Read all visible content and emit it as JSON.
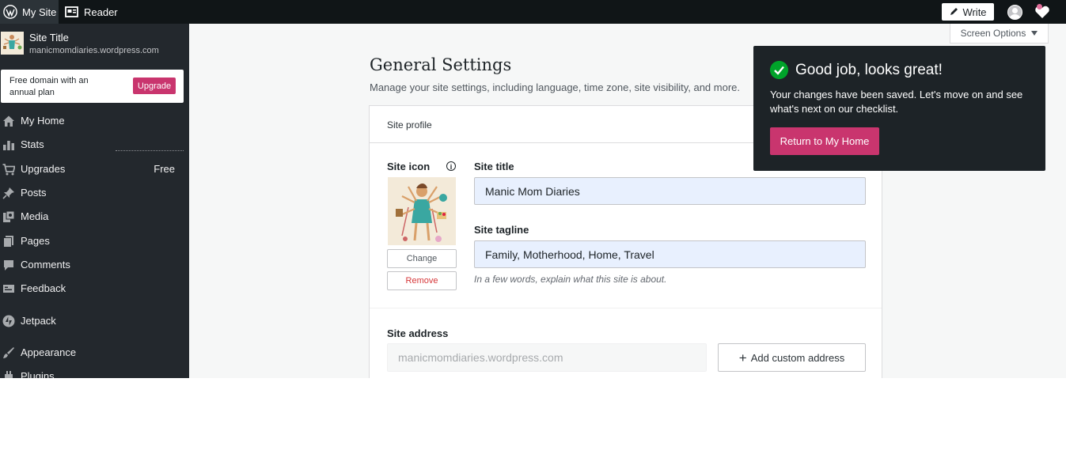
{
  "topbar": {
    "my_site": "My Site",
    "reader": "Reader",
    "write": "Write",
    "icons": [
      "wordpress-icon",
      "reader-icon",
      "pencil-icon",
      "avatar-icon",
      "notifications-icon"
    ]
  },
  "sidebar": {
    "site_title": "Site Title",
    "site_url": "manicmomdiaries.wordpress.com",
    "domain_promo": "Free domain with an annual plan",
    "upgrade_label": "Upgrade",
    "items": [
      {
        "label": "My Home",
        "icon": "home-icon"
      },
      {
        "label": "Stats",
        "icon": "stats-icon"
      },
      {
        "label": "Upgrades",
        "icon": "cart-icon",
        "badge": "Free"
      },
      {
        "label": "Posts",
        "icon": "pin-icon"
      },
      {
        "label": "Media",
        "icon": "media-icon"
      },
      {
        "label": "Pages",
        "icon": "pages-icon"
      },
      {
        "label": "Comments",
        "icon": "comment-icon"
      },
      {
        "label": "Feedback",
        "icon": "feedback-icon"
      },
      {
        "label": "Jetpack",
        "icon": "jetpack-icon"
      },
      {
        "label": "Appearance",
        "icon": "brush-icon"
      },
      {
        "label": "Plugins",
        "icon": "plugin-icon"
      }
    ]
  },
  "main": {
    "screen_options": "Screen Options",
    "title": "General Settings",
    "subtitle": "Manage your site settings, including language, time zone, site visibility, and more.",
    "card_header": "Site profile",
    "site_icon_label": "Site icon",
    "change_label": "Change",
    "remove_label": "Remove",
    "site_title_label": "Site title",
    "site_title_value": "Manic Mom Diaries",
    "site_tagline_label": "Site tagline",
    "site_tagline_value": "Family, Motherhood, Home, Travel",
    "tagline_help": "In a few words, explain what this site is about.",
    "site_address_label": "Site address",
    "site_address_placeholder": "manicmomdiaries.wordpress.com",
    "add_custom_address": "Add custom address"
  },
  "toast": {
    "title": "Good job, looks great!",
    "body": "Your changes have been saved. Let's move on and see what's next on our checklist.",
    "button": "Return to My Home"
  },
  "colors": {
    "accent": "#c9356e",
    "sidebar_bg": "#23282d",
    "topbar_bg": "#101517",
    "success": "#00a32a"
  }
}
